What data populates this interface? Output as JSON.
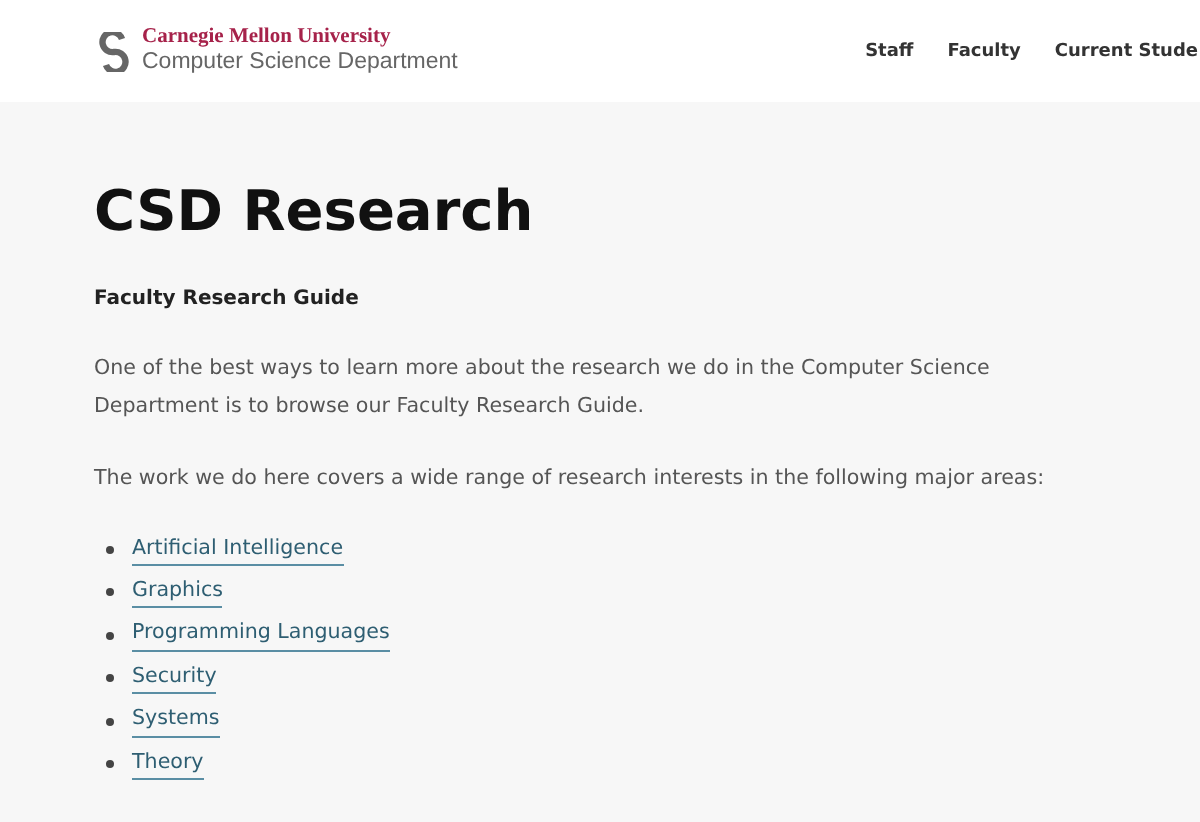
{
  "header": {
    "logo": {
      "university": "Carnegie Mellon University",
      "department": "Computer Science Department"
    },
    "nav": [
      "Staff",
      "Faculty",
      "Current Stude"
    ]
  },
  "page": {
    "title": "CSD Research",
    "subtitle": "Faculty Research Guide",
    "paragraphs": [
      "One of the best ways to learn more about the research we do in the Computer Science Department is to browse our Faculty Research Guide.",
      "The work we do here covers a wide range of research interests in the following major areas:"
    ],
    "areas": [
      "Artificial Intelligence",
      "Graphics",
      "Programming Languages",
      "Security",
      "Systems",
      "Theory"
    ]
  }
}
